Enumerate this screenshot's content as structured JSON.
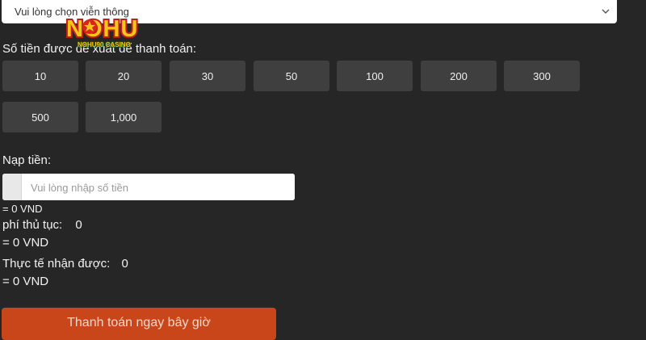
{
  "carrier_select": {
    "value": "Vui lòng chọn viễn thông"
  },
  "logo": {
    "main_text": "NOHU",
    "sub_text": "NOHU90 CASINO",
    "colors": {
      "text": "#f5c518",
      "outline": "#c01e1e",
      "star": "#f5c518"
    }
  },
  "suggested": {
    "label": "Số tiền được đề xuất để thanh toán:",
    "amounts": [
      "10",
      "20",
      "30",
      "50",
      "100",
      "200",
      "300",
      "500",
      "1,000"
    ]
  },
  "deposit": {
    "label": "Nạp tiền:",
    "placeholder": "Vui lòng nhập số tiền",
    "converted": "= 0 VND"
  },
  "fee": {
    "label": "phí thủ tục:",
    "value": "0",
    "converted": "= 0 VND"
  },
  "received": {
    "label": "Thực tế nhận được:",
    "value": "0",
    "converted": "= 0 VND"
  },
  "pay_button": {
    "label": "Thanh toán ngay bây giờ"
  },
  "colors": {
    "background": "#262626",
    "button": "#3f3f3f",
    "accent": "#c9461a"
  }
}
